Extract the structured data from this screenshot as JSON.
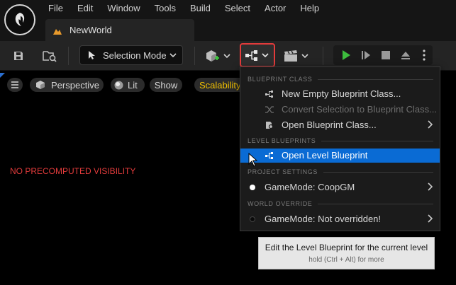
{
  "menubar": {
    "items": [
      "File",
      "Edit",
      "Window",
      "Tools",
      "Build",
      "Select",
      "Actor",
      "Help"
    ]
  },
  "document_tab": {
    "label": "NewWorld"
  },
  "toolbar": {
    "mode_label": "Selection Mode",
    "icons": [
      "save-icon",
      "browse-icon",
      "cursor-mode-icon",
      "add-actor-icon",
      "blueprint-icon",
      "cinematics-icon",
      "play-icon",
      "step-icon",
      "stop-icon",
      "eject-icon",
      "more-icon"
    ]
  },
  "viewport": {
    "perspective_label": "Perspective",
    "lit_label": "Lit",
    "show_label": "Show",
    "scalability_label": "Scalability",
    "warning_text": "NO PRECOMPUTED VISIBILITY",
    "warning_color": "#e23b3b"
  },
  "dropdown": {
    "sections": {
      "blueprint_class": "BLUEPRINT CLASS",
      "level_blueprints": "LEVEL BLUEPRINTS",
      "project_settings": "PROJECT SETTINGS",
      "world_override": "WORLD OVERRIDE"
    },
    "items": {
      "new_bp": "New Empty Blueprint Class...",
      "convert": "Convert Selection to Blueprint Class...",
      "open_bp": "Open Blueprint Class...",
      "open_level_bp": "Open Level Blueprint",
      "gamemode_project": "GameMode: CoopGM",
      "gamemode_world": "GameMode: Not overridden!"
    },
    "highlight_color": "#0a6bd4"
  },
  "tooltip": {
    "title": "Edit the Level Blueprint for the current level",
    "hint": "hold (Ctrl + Alt) for more"
  }
}
